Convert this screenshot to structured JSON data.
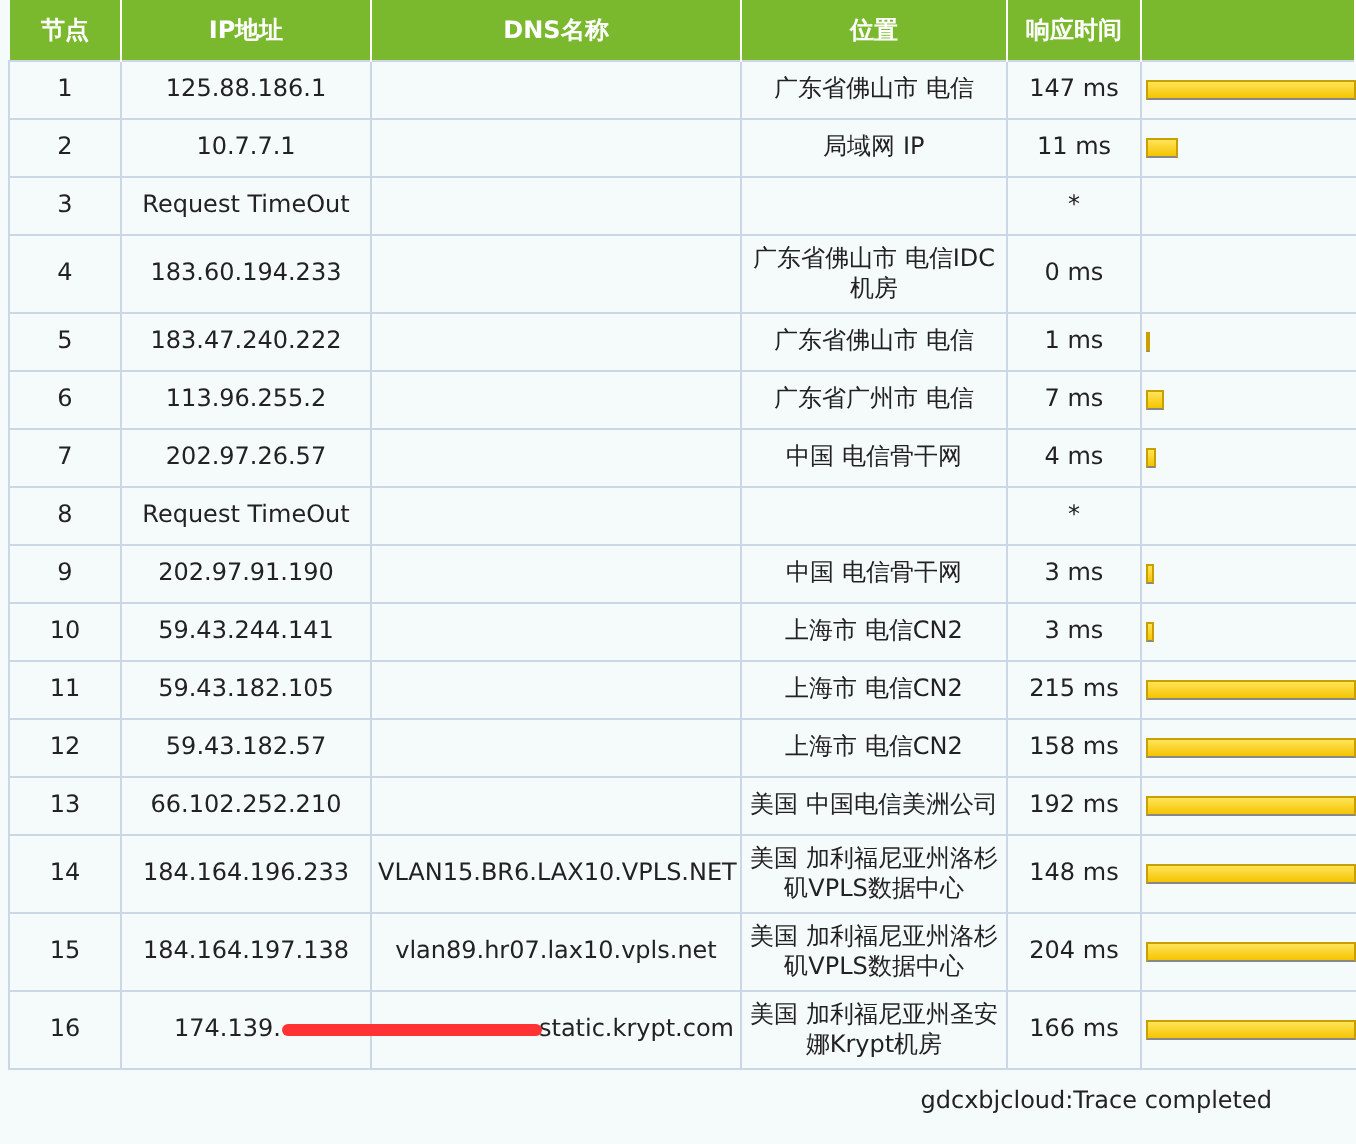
{
  "table": {
    "columns": [
      "节点",
      "IP地址",
      "DNS名称",
      "位置",
      "响应时间"
    ],
    "rows": [
      {
        "node": "1",
        "ip": "125.88.186.1",
        "dns": "",
        "location": "广东省佛山市 电信",
        "time": "147 ms",
        "level": 1
      },
      {
        "node": "2",
        "ip": "10.7.7.1",
        "dns": "",
        "location": "局域网 IP",
        "time": "11 ms",
        "level": 0.15
      },
      {
        "node": "3",
        "ip": "Request TimeOut",
        "dns": "",
        "location": "",
        "time": "*"
      },
      {
        "node": "4",
        "ip": "183.60.194.233",
        "dns": "",
        "location": "广东省佛山市 电信IDC机房",
        "time": "0 ms"
      },
      {
        "node": "5",
        "ip": "183.47.240.222",
        "dns": "",
        "location": "广东省佛山市 电信",
        "time": "1 ms",
        "level": 0.01
      },
      {
        "node": "6",
        "ip": "113.96.255.2",
        "dns": "",
        "location": "广东省广州市 电信",
        "time": "7 ms",
        "level": 0.09
      },
      {
        "node": "7",
        "ip": "202.97.26.57",
        "dns": "",
        "location": "中国 电信骨干网",
        "time": "4 ms",
        "level": 0.05
      },
      {
        "node": "8",
        "ip": "Request TimeOut",
        "dns": "",
        "location": "",
        "time": "*"
      },
      {
        "node": "9",
        "ip": "202.97.91.190",
        "dns": "",
        "location": "中国 电信骨干网",
        "time": "3 ms",
        "level": 0.04
      },
      {
        "node": "10",
        "ip": "59.43.244.141",
        "dns": "",
        "location": "上海市 电信CN2",
        "time": "3 ms",
        "level": 0.04
      },
      {
        "node": "11",
        "ip": "59.43.182.105",
        "dns": "",
        "location": "上海市 电信CN2",
        "time": "215 ms",
        "level": 1
      },
      {
        "node": "12",
        "ip": "59.43.182.57",
        "dns": "",
        "location": "上海市 电信CN2",
        "time": "158 ms",
        "level": 1
      },
      {
        "node": "13",
        "ip": "66.102.252.210",
        "dns": "",
        "location": "美国 中国电信美洲公司",
        "time": "192 ms",
        "level": 1
      },
      {
        "node": "14",
        "ip": "184.164.196.233",
        "dns": "VLAN15.BR6.LAX10.VPLS.NET",
        "location": "美国 加利福尼亚州洛杉矶VPLS数据中心",
        "time": "148 ms",
        "level": 1
      },
      {
        "node": "15",
        "ip": "184.164.197.138",
        "dns": "vlan89.hr07.lax10.vpls.net",
        "location": "美国 加利福尼亚州洛杉矶VPLS数据中心",
        "time": "204 ms",
        "level": 1
      },
      {
        "node": "16",
        "ip": "174.139.",
        "dns": "static.krypt.com",
        "location": "美国 加利福尼亚州圣安娜Krypt机房",
        "time": "166 ms",
        "level": 1,
        "redacted": true
      }
    ]
  },
  "status": "gdcxbjcloud:Trace completed"
}
